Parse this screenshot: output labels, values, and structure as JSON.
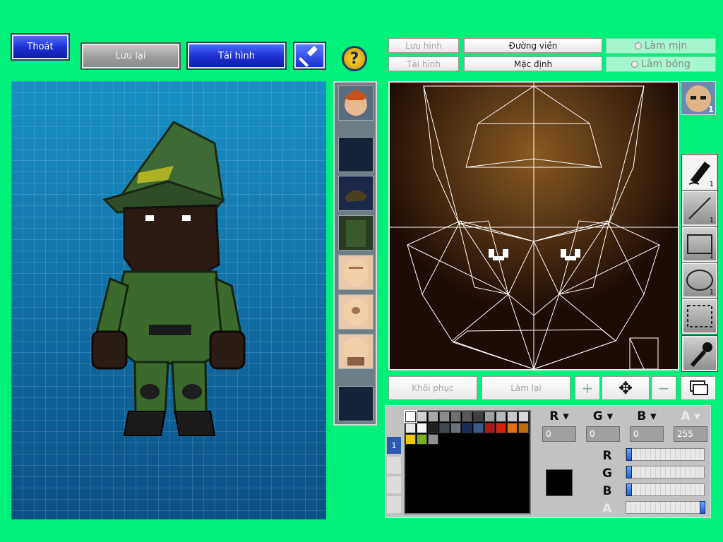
{
  "toolbar": {
    "exit_label": "Thoát",
    "save_label": "Lưu lại",
    "reload_label": "Tải hình"
  },
  "editor_toolbar": {
    "save_image_label": "Lưu hình",
    "load_image_label": "Tải hình",
    "outline_label": "Đường viền",
    "default_label": "Mặc định",
    "smooth_label": "Làm mịn",
    "gloss_label": "Làm bóng"
  },
  "layer_badge": "1",
  "tool_counts": [
    "1",
    "1",
    "1",
    "1"
  ],
  "bottom_controls": {
    "restore_label": "Khôi phục",
    "redo_label": "Làm lại",
    "plus_glyph": "+",
    "minus_glyph": "−",
    "move_glyph": "✥"
  },
  "palette": {
    "tab_label": "1",
    "channels": [
      {
        "label": "R",
        "value": "0",
        "slider": 0.0
      },
      {
        "label": "G",
        "value": "0",
        "slider": 0.0
      },
      {
        "label": "B",
        "value": "0",
        "slider": 0.0
      },
      {
        "label": "A",
        "value": "255",
        "slider": 1.0
      }
    ],
    "current_color": "#000000",
    "swatch_rows": [
      [
        "#ffffff",
        "#d0d0d0",
        "#a8a8a8",
        "#8c8c8c",
        "#707070",
        "#585858",
        "#404040",
        "#a0a0a0",
        "#b8b8b8",
        "#c8c8c8",
        "#d8d8d8"
      ],
      [
        "#e8e8e8",
        "#f4f4f4",
        "#202020",
        "#404850",
        "#6a7080",
        "#1a2a5a",
        "#3a5a8a",
        "#b01818",
        "#d82010",
        "#e07010",
        "#b87010"
      ],
      [
        "#f0c800",
        "#7ab020",
        "#909090"
      ]
    ]
  },
  "colors": {
    "background": "#00f07a",
    "accent_blue": "#1a2fd0"
  }
}
